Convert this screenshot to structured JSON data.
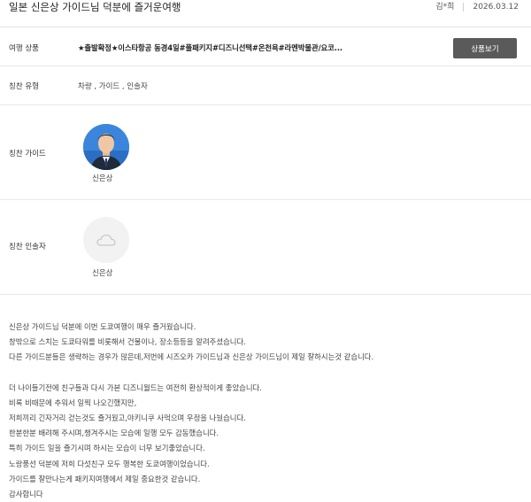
{
  "header": {
    "title": "일본 신은상 가이드님 덕분에 즐거운여행",
    "author": "김*희",
    "date": "2026.03.12"
  },
  "product": {
    "label": "여행 상품",
    "value": "★출발확정★이스타항공 동경4일#풀패키지#디즈니선택#온천욕#라멘박물관/요코...",
    "button_label": "상품보기"
  },
  "praise_type": {
    "label": "칭찬 유형",
    "value": "차량 , 가이드 , 인솔자"
  },
  "guide": {
    "label": "칭찬 가이드",
    "name": "신은상"
  },
  "escort": {
    "label": "칭찬 인솔자",
    "name": "신은상"
  },
  "review": {
    "paragraph1": [
      "신은상 가이드님 덕분에 이번 도쿄여행이 매우 즐거웠습니다.",
      "창밖으로 스치는 도쿄타워를 비롯해서 건물이나, 장소등등을 알려주셨습니다.",
      "다른 가이드분들은 생략하는 경우가 많은데,저번에 시즈오카 가이드님과 신은상 가이드님이 제일 잘하시는것 같습니다."
    ],
    "paragraph2": [
      "더 나이들기전에 친구들과 다시 가본 디즈니월드는 여전히 환상적이게 좋았습니다.",
      "비록 비때문에 추워서 일찍 나오긴했지만,",
      "저희끼리 긴자거리 걷는것도 즐거웠고,야키니쿠 사먹으며 우정을 나눴습니다.",
      "한분한분 배려해 주시며,챙겨주시는 모습에 일행 모두 감동했습니다.",
      "특히 가이드 일을 즐기시며 하시는 모습이 너무 보기좋았습니다.",
      "노랑풍선 덕분에 저희 다섯친구 모두 행복한 도쿄여행이었습니다.",
      "가이드를 잘만나는게 패키지여행에서 제일 중요한것 같습니다.",
      "감사합니다"
    ]
  },
  "icons": {
    "avatar_photo": "guide-photo",
    "placeholder": "cloud-icon"
  },
  "colors": {
    "button_bg": "#5a5a5a",
    "avatar_bg": "#3a85db"
  }
}
